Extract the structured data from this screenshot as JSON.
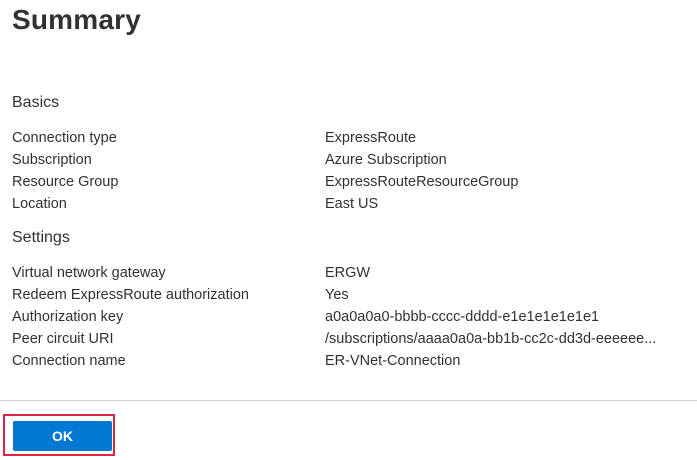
{
  "header": {
    "title": "Summary"
  },
  "basics": {
    "heading": "Basics",
    "rows": [
      {
        "label": "Connection type",
        "value": "ExpressRoute"
      },
      {
        "label": "Subscription",
        "value": "Azure Subscription"
      },
      {
        "label": "Resource Group",
        "value": "ExpressRouteResourceGroup"
      },
      {
        "label": "Location",
        "value": "East US"
      }
    ]
  },
  "settings": {
    "heading": "Settings",
    "rows": [
      {
        "label": "Virtual network gateway",
        "value": "ERGW"
      },
      {
        "label": "Redeem ExpressRoute authorization",
        "value": "Yes"
      },
      {
        "label": "Authorization key",
        "value": "a0a0a0a0-bbbb-cccc-dddd-e1e1e1e1e1e1"
      },
      {
        "label": "Peer circuit URI",
        "value": "/subscriptions/aaaa0a0a-bb1b-cc2c-dd3d-eeeeee..."
      },
      {
        "label": "Connection name",
        "value": "ER-VNet-Connection"
      }
    ]
  },
  "footer": {
    "ok_label": "OK",
    "highlight_color": "#e0224b",
    "button_color": "#0078d4"
  }
}
